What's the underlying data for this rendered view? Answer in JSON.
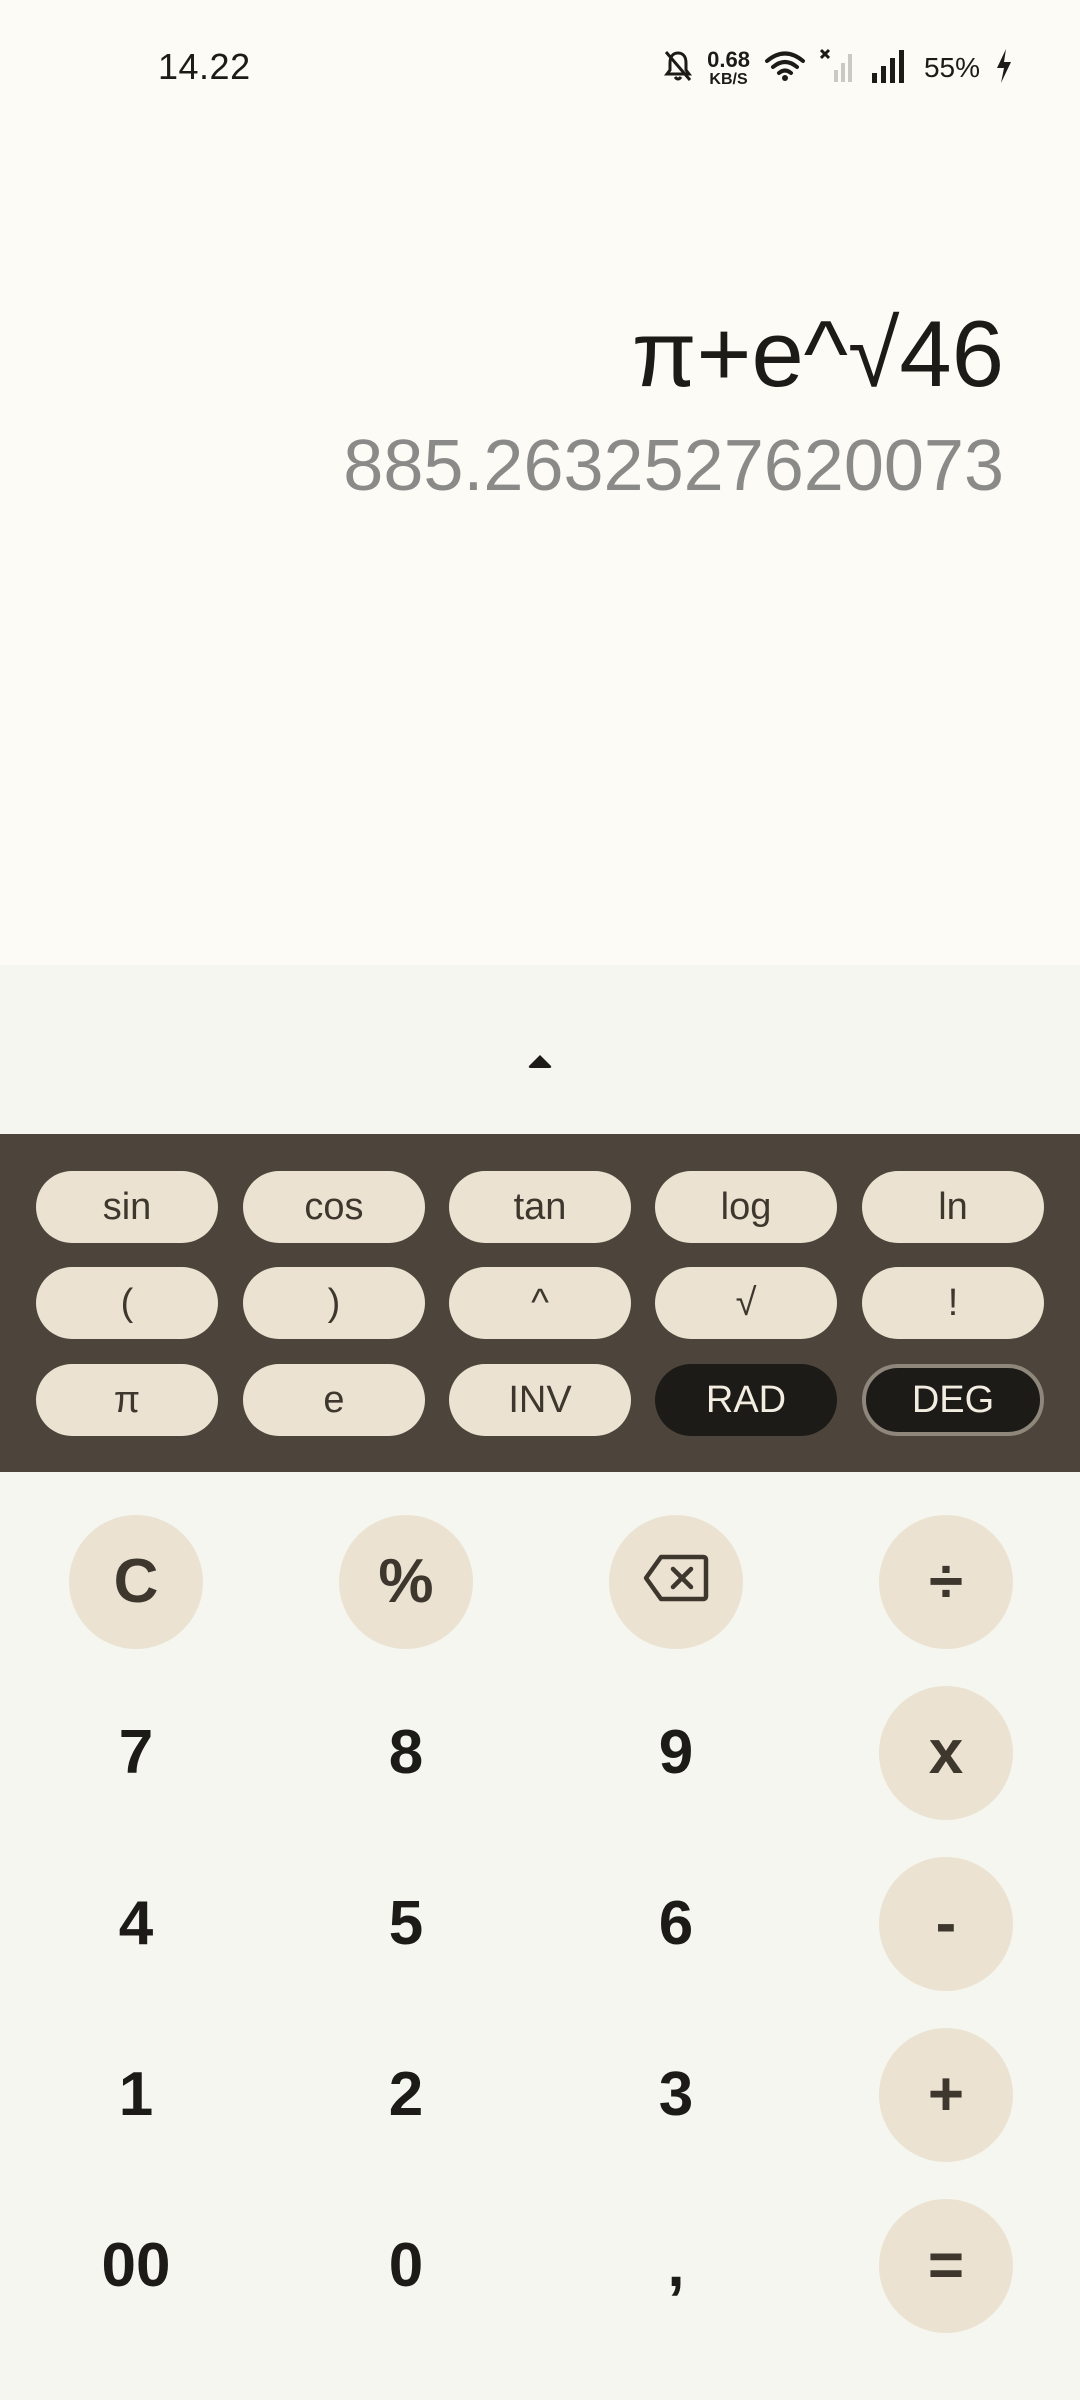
{
  "status_bar": {
    "time": "14.22",
    "net_speed_value": "0.68",
    "net_speed_unit": "KB/S",
    "battery": "55%",
    "icons": [
      "bell-off-icon",
      "wifi-icon",
      "sim-no-signal-icon",
      "signal-icon",
      "charging-icon"
    ]
  },
  "display": {
    "expression": "π+e^√46",
    "result": "885.2632527620073"
  },
  "scientific": {
    "row1": [
      "sin",
      "cos",
      "tan",
      "log",
      "ln"
    ],
    "row2": [
      "(",
      ")",
      "^",
      "√",
      "!"
    ],
    "row3": [
      "π",
      "e",
      "INV",
      "RAD",
      "DEG"
    ]
  },
  "keypad": {
    "clear": "C",
    "percent": "%",
    "backspace_icon": "backspace-icon",
    "divide": "÷",
    "seven": "7",
    "eight": "8",
    "nine": "9",
    "multiply": "x",
    "four": "4",
    "five": "5",
    "six": "6",
    "minus": "-",
    "one": "1",
    "two": "2",
    "three": "3",
    "plus": "+",
    "double_zero": "00",
    "zero": "0",
    "decimal": ",",
    "equals": "="
  },
  "colors": {
    "background": "#fdfbf5",
    "keypad_background": "#f4f6ef",
    "scientific_panel": "#4d453b",
    "button_tint": "#ebe2d1",
    "active_dark": "#1d1b18",
    "result_text": "#8a8a88"
  }
}
